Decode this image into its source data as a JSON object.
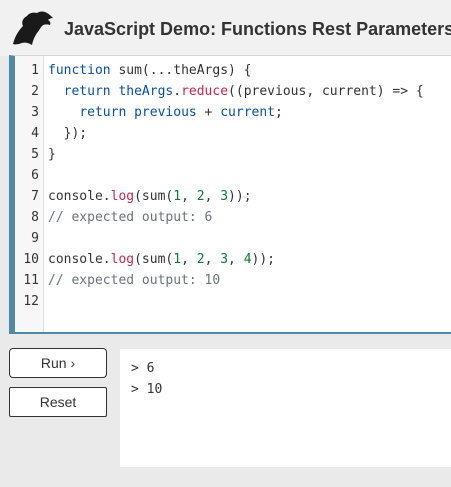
{
  "header": {
    "title": "JavaScript Demo: Functions Rest Parameters",
    "logo_icon": "dinosaur-logo-icon"
  },
  "editor": {
    "lines": [
      {
        "number": "1",
        "tokens": [
          {
            "t": "function",
            "k": "keyword"
          },
          {
            "t": " sum(...theArgs) {",
            "k": "text"
          }
        ]
      },
      {
        "number": "2",
        "tokens": [
          {
            "t": "  ",
            "k": "text"
          },
          {
            "t": "return",
            "k": "keyword"
          },
          {
            "t": " ",
            "k": "text"
          },
          {
            "t": "theArgs",
            "k": "var"
          },
          {
            "t": ".",
            "k": "text"
          },
          {
            "t": "reduce",
            "k": "method"
          },
          {
            "t": "((previous, current) => {",
            "k": "text"
          }
        ]
      },
      {
        "number": "3",
        "tokens": [
          {
            "t": "    ",
            "k": "text"
          },
          {
            "t": "return",
            "k": "keyword"
          },
          {
            "t": " ",
            "k": "text"
          },
          {
            "t": "previous",
            "k": "var"
          },
          {
            "t": " + ",
            "k": "text"
          },
          {
            "t": "current",
            "k": "var"
          },
          {
            "t": ";",
            "k": "text"
          }
        ]
      },
      {
        "number": "4",
        "tokens": [
          {
            "t": "  });",
            "k": "text"
          }
        ]
      },
      {
        "number": "5",
        "tokens": [
          {
            "t": "}",
            "k": "text"
          }
        ]
      },
      {
        "number": "6",
        "tokens": []
      },
      {
        "number": "7",
        "tokens": [
          {
            "t": "console.",
            "k": "text"
          },
          {
            "t": "log",
            "k": "method"
          },
          {
            "t": "(sum(",
            "k": "text"
          },
          {
            "t": "1",
            "k": "number"
          },
          {
            "t": ", ",
            "k": "text"
          },
          {
            "t": "2",
            "k": "number"
          },
          {
            "t": ", ",
            "k": "text"
          },
          {
            "t": "3",
            "k": "number"
          },
          {
            "t": "));",
            "k": "text"
          }
        ]
      },
      {
        "number": "8",
        "tokens": [
          {
            "t": "// expected output: 6",
            "k": "comment"
          }
        ]
      },
      {
        "number": "9",
        "tokens": []
      },
      {
        "number": "10",
        "tokens": [
          {
            "t": "console.",
            "k": "text"
          },
          {
            "t": "log",
            "k": "method"
          },
          {
            "t": "(sum(",
            "k": "text"
          },
          {
            "t": "1",
            "k": "number"
          },
          {
            "t": ", ",
            "k": "text"
          },
          {
            "t": "2",
            "k": "number"
          },
          {
            "t": ", ",
            "k": "text"
          },
          {
            "t": "3",
            "k": "number"
          },
          {
            "t": ", ",
            "k": "text"
          },
          {
            "t": "4",
            "k": "number"
          },
          {
            "t": "));",
            "k": "text"
          }
        ]
      },
      {
        "number": "11",
        "tokens": [
          {
            "t": "// expected output: 10",
            "k": "comment"
          }
        ]
      },
      {
        "number": "12",
        "tokens": []
      }
    ]
  },
  "controls": {
    "run_label": "Run ›",
    "reset_label": "Reset"
  },
  "output": {
    "lines": [
      "> 6",
      "> 10"
    ]
  },
  "colors": {
    "accent": "#4d8aa6",
    "keyword": "#0550ae",
    "method": "#c7254e",
    "number": "#0a7a2f",
    "comment": "#6a737d"
  }
}
